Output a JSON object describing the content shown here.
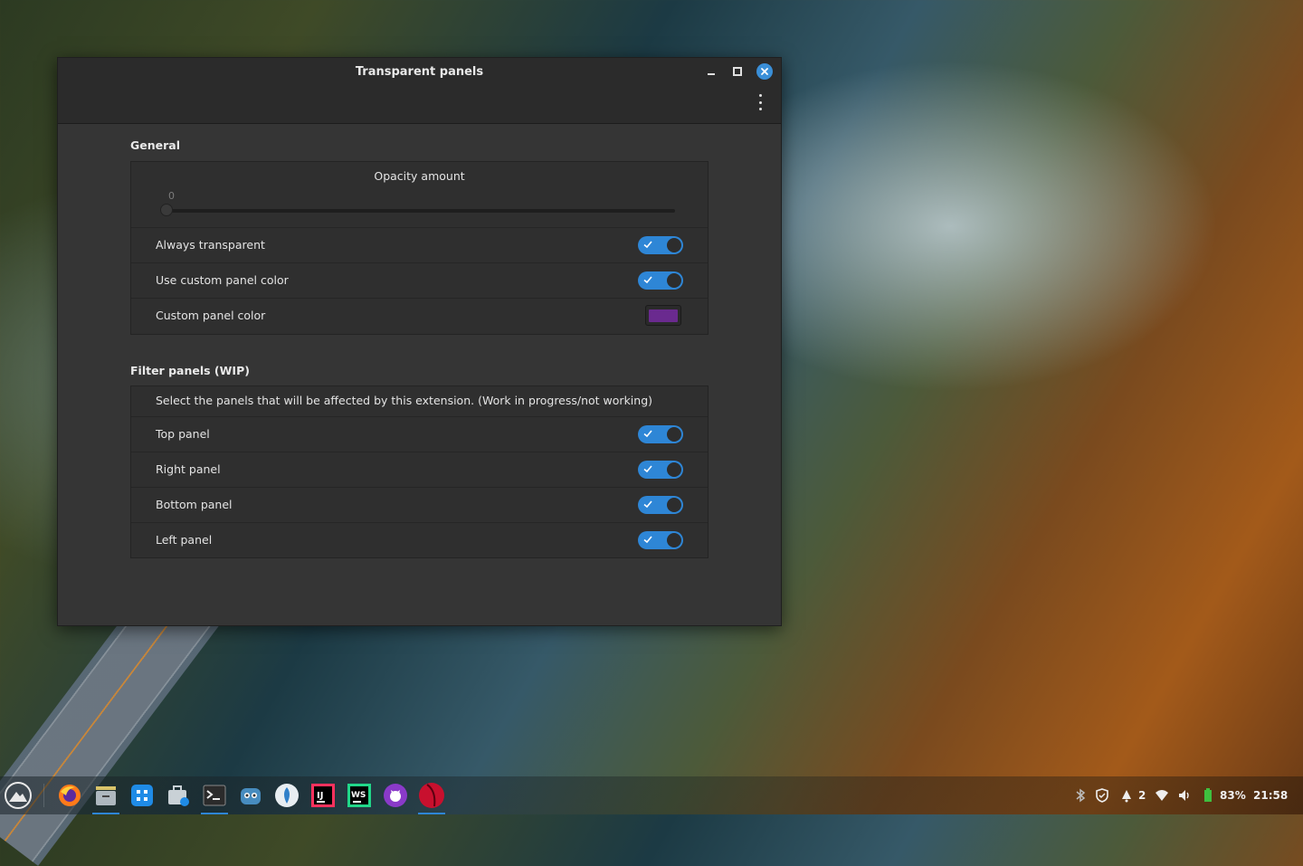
{
  "window": {
    "title": "Transparent panels"
  },
  "general": {
    "section_title": "General",
    "opacity_label": "Opacity amount",
    "opacity_value": "0",
    "opacity_fraction": 0,
    "rows": [
      {
        "label": "Always transparent",
        "enabled": true
      },
      {
        "label": "Use custom panel color",
        "enabled": true
      }
    ],
    "custom_color_label": "Custom panel color",
    "custom_color": "#6a2a8f"
  },
  "filter": {
    "section_title": "Filter panels (WIP)",
    "description": "Select the panels that will be affected by this extension. (Work in progress/not working)",
    "rows": [
      {
        "label": "Top panel",
        "enabled": true
      },
      {
        "label": "Right panel",
        "enabled": true
      },
      {
        "label": "Bottom panel",
        "enabled": true
      },
      {
        "label": "Left panel",
        "enabled": true
      }
    ]
  },
  "taskbar": {
    "apps": [
      "menu-icon",
      "firefox-icon",
      "files-icon",
      "app-center-icon",
      "store-icon",
      "terminal-icon",
      "godot-icon",
      "vscodium-icon",
      "intellij-icon",
      "webstorm-icon",
      "github-icon",
      "extension-icon"
    ],
    "tray": {
      "notifications_count": "2",
      "battery": "83%",
      "time": "21:58"
    }
  },
  "colors": {
    "accent": "#2e86d6",
    "window_bg": "#353535",
    "titlebar_bg": "#2b2b2b"
  }
}
